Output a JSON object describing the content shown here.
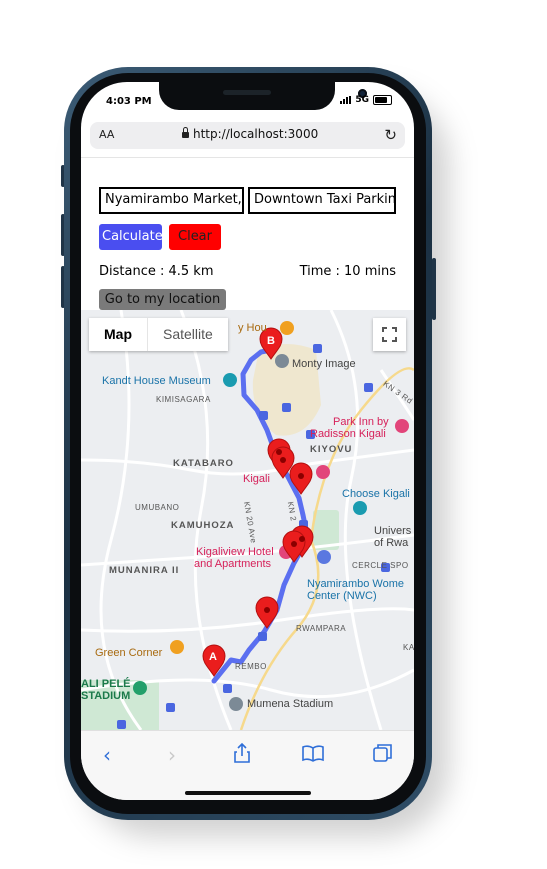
{
  "status_bar": {
    "time": "4:03 PM",
    "network": "5G"
  },
  "browser": {
    "aa_label": "AA",
    "url": "http://localhost:3000"
  },
  "form": {
    "origin_value": "Nyamirambo Market, K",
    "destination_value": "Downtown Taxi Parking",
    "calculate_label": "Calculate",
    "clear_label": "Clear",
    "distance_text": "Distance : 4.5 km",
    "time_text": "Time : 10 mins",
    "location_label": "Go to my location"
  },
  "map": {
    "map_tab": "Map",
    "satellite_tab": "Satellite",
    "marker_a": "A",
    "marker_b": "B",
    "labels": {
      "monty_image": "Monty Image",
      "kandt_house": "Kandt House Museum",
      "kimisagara": "KIMISAGARA",
      "park_inn": "Park Inn by",
      "radisson": "Radisson Kigali",
      "kiyovu": "KIYOVU",
      "katabaro": "KATABARO",
      "kigali": "Kigali",
      "choose_kigali": "Choose Kigali",
      "umubano": "UMUBANO",
      "kamuhoza": "KAMUHOZA",
      "kn2": "KN 2",
      "kn20": "KN 20 Ave",
      "univers": "Univers",
      "of_rwa": "of Rwa",
      "cercle": "CERCLE SPO",
      "kigaliview": "Kigaliview Hotel",
      "apartments": "and Apartments",
      "munanira": "MUNANIRA II",
      "nwc1": "Nyamirambo Wome",
      "nwc2": "Center (NWC)",
      "rwampara": "RWAMPARA",
      "green_corner": "Green Corner",
      "rembo": "REMBO",
      "pele1": "ALI PELÉ",
      "pele2": "STADIUM",
      "mumena": "Mumena Stadium",
      "kn3": "KN 3 Rd",
      "ka": "KA",
      "house": "y Hou"
    }
  },
  "colors": {
    "route": "#5b6ff0",
    "marker": "#ea1d1d",
    "calculate": "#4a4ef0",
    "clear": "#ff0000"
  }
}
